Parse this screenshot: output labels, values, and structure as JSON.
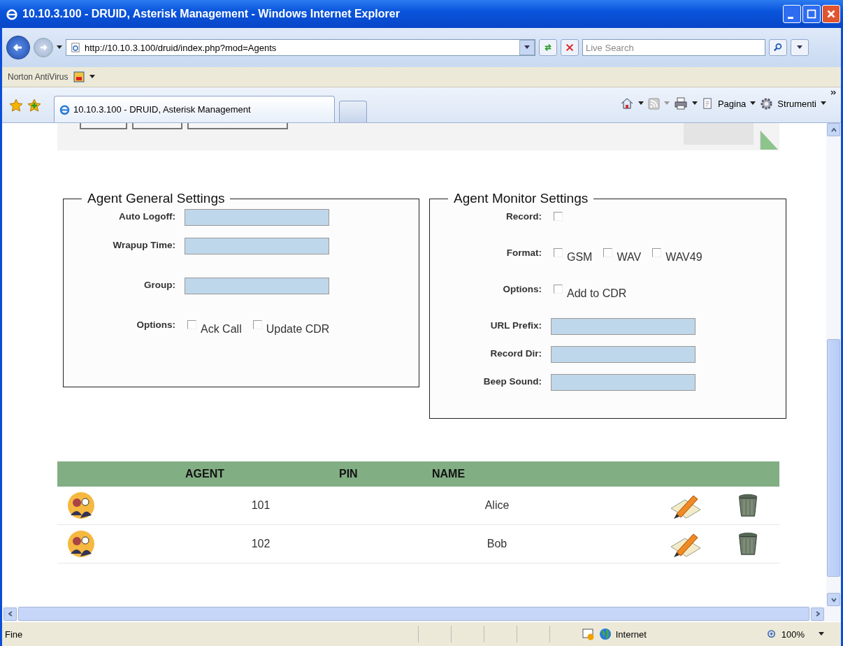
{
  "window": {
    "title": "10.10.3.100 - DRUID, Asterisk Management - Windows Internet Explorer"
  },
  "address_bar": {
    "url": "http://10.10.3.100/druid/index.php?mod=Agents",
    "search_placeholder": "Live Search"
  },
  "links_bar": {
    "label": "Norton AntiVirus"
  },
  "tabs": [
    {
      "label": "10.10.3.100 - DRUID, Asterisk Management",
      "selected": true
    }
  ],
  "command_bar": {
    "page": "Pagina",
    "tools": "Strumenti"
  },
  "general_settings": {
    "legend": "Agent General Settings",
    "rows": [
      {
        "kind": "text",
        "label": "Auto Logoff:"
      },
      {
        "kind": "text",
        "label": "Wrapup Time:"
      },
      {
        "kind": "text",
        "label": "Group:"
      },
      {
        "kind": "checks",
        "label": "Options:",
        "options": [
          {
            "label": "Ack Call",
            "checked": false
          },
          {
            "label": "Update CDR",
            "checked": false
          }
        ]
      }
    ]
  },
  "monitor_settings": {
    "legend": "Agent Monitor Settings",
    "rows": [
      {
        "kind": "checks",
        "label": "Record:",
        "options": [
          {
            "checked": false
          }
        ]
      },
      {
        "kind": "checks",
        "label": "Format:",
        "options": [
          {
            "label": "GSM",
            "checked": false
          },
          {
            "label": "WAV",
            "checked": false
          },
          {
            "label": "WAV49",
            "checked": false
          }
        ]
      },
      {
        "kind": "checks",
        "label": "Options:",
        "options": [
          {
            "label": "Add to CDR",
            "checked": false
          }
        ]
      },
      {
        "kind": "text",
        "label": "URL Prefix:"
      },
      {
        "kind": "text",
        "label": "Record Dir:"
      },
      {
        "kind": "text",
        "label": "Beep Sound:"
      }
    ]
  },
  "table": {
    "columns": [
      "AGENT",
      "PIN",
      "NAME"
    ],
    "rows": [
      {
        "agent": "101",
        "name": "Alice"
      },
      {
        "agent": "102",
        "name": "Bob"
      }
    ]
  },
  "status_bar": {
    "text": "Fine",
    "zone": "Internet",
    "zoom": "100%"
  }
}
